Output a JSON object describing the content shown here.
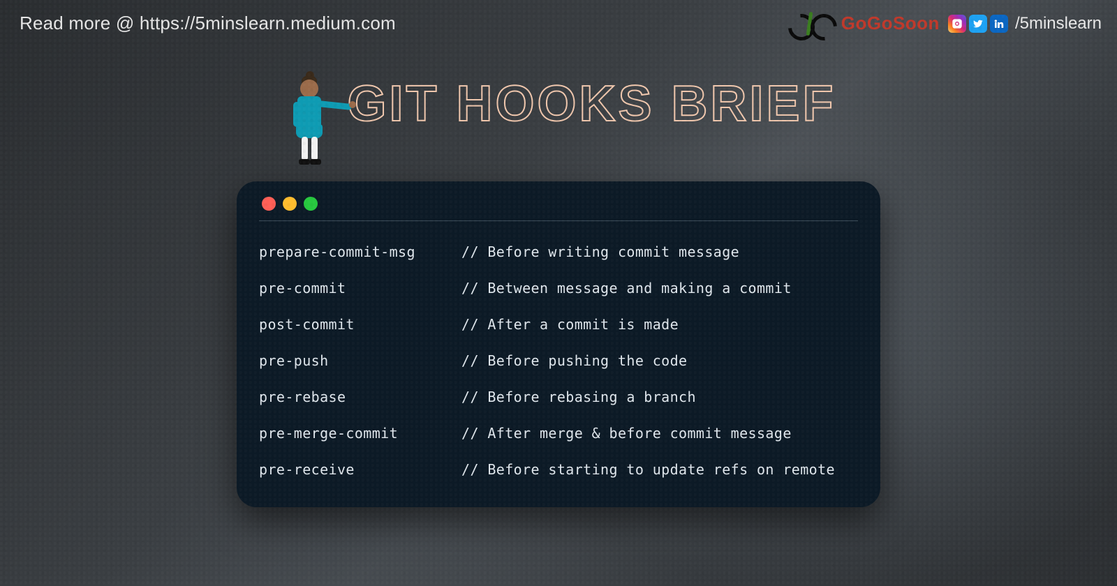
{
  "header": {
    "read_more": "Read more @ https://5minslearn.medium.com",
    "brand": "GoGoSoon",
    "handle": "/5minslearn"
  },
  "title": "GIT HOOKS BRIEF",
  "hooks": [
    {
      "name": "prepare-commit-msg",
      "desc": "// Before writing commit message"
    },
    {
      "name": "pre-commit",
      "desc": "// Between message and making a commit"
    },
    {
      "name": "post-commit",
      "desc": "// After a commit is made"
    },
    {
      "name": "pre-push",
      "desc": "// Before pushing the code"
    },
    {
      "name": "pre-rebase",
      "desc": "// Before rebasing a branch"
    },
    {
      "name": "pre-merge-commit",
      "desc": "// After merge & before commit message"
    },
    {
      "name": "pre-receive",
      "desc": "// Before starting to update refs on remote"
    }
  ]
}
